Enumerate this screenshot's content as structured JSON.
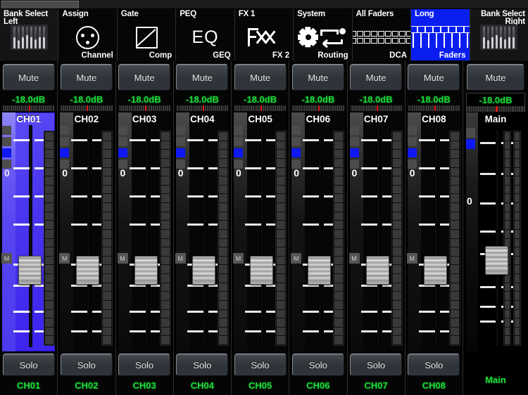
{
  "app": {
    "titlebar_tab": ""
  },
  "toolbar": [
    {
      "name": "bank-select-left",
      "top": "Bank Select",
      "top2": "Left",
      "bottom": "",
      "icon": "faders-icon",
      "active": false,
      "style": "bank"
    },
    {
      "name": "assign-channel",
      "top": "Assign",
      "top2": "",
      "bottom": "Channel",
      "icon": "xlr-connector-icon",
      "active": false,
      "style": "normal"
    },
    {
      "name": "gate-comp",
      "top": "Gate",
      "top2": "",
      "bottom": "Comp",
      "icon": "compressor-curve-icon",
      "active": false,
      "style": "normal"
    },
    {
      "name": "peq-geq",
      "top": "PEQ",
      "top2": "",
      "bottom": "GEQ",
      "icon": "eq-text-icon",
      "active": false,
      "style": "normal"
    },
    {
      "name": "fx1-fx2",
      "top": "FX 1",
      "top2": "",
      "bottom": "FX 2",
      "icon": "fx-icon",
      "active": false,
      "style": "normal"
    },
    {
      "name": "system-routing",
      "top": "System",
      "top2": "",
      "bottom": "Routing",
      "icon": "gear-routing-icon",
      "active": false,
      "style": "normal"
    },
    {
      "name": "all-faders-dca",
      "top": "All Faders",
      "top2": "",
      "bottom": "DCA",
      "icon": "dca-grid-icon",
      "active": false,
      "style": "normal"
    },
    {
      "name": "long-faders",
      "top": "Long",
      "top2": "",
      "bottom": "Faders",
      "icon": "long-faders-icon",
      "active": true,
      "style": "normal"
    },
    {
      "name": "bank-select-right",
      "top": "Bank Select",
      "top2": "Right",
      "bottom": "",
      "icon": "faders-icon",
      "active": false,
      "style": "bank"
    }
  ],
  "labels": {
    "mute": "Mute",
    "solo": "Solo",
    "zero": "0",
    "m": "M"
  },
  "channels": [
    {
      "name": "CH01",
      "db": "-18.0dB",
      "selected": true
    },
    {
      "name": "CH02",
      "db": "-18.0dB",
      "selected": false
    },
    {
      "name": "CH03",
      "db": "-18.0dB",
      "selected": false
    },
    {
      "name": "CH04",
      "db": "-18.0dB",
      "selected": false
    },
    {
      "name": "CH05",
      "db": "-18.0dB",
      "selected": false
    },
    {
      "name": "CH06",
      "db": "-18.0dB",
      "selected": false
    },
    {
      "name": "CH07",
      "db": "-18.0dB",
      "selected": false
    },
    {
      "name": "CH08",
      "db": "-18.0dB",
      "selected": false
    }
  ],
  "main": {
    "name": "Main",
    "db": "-18.0dB",
    "mute": "Mute"
  },
  "colors": {
    "accent_blue": "#0b1ef0",
    "selected_strip": "#4a37ef",
    "readout_green": "#1ddb3a",
    "meter_red": "#e01b1b",
    "button_face": "#2e3338"
  }
}
